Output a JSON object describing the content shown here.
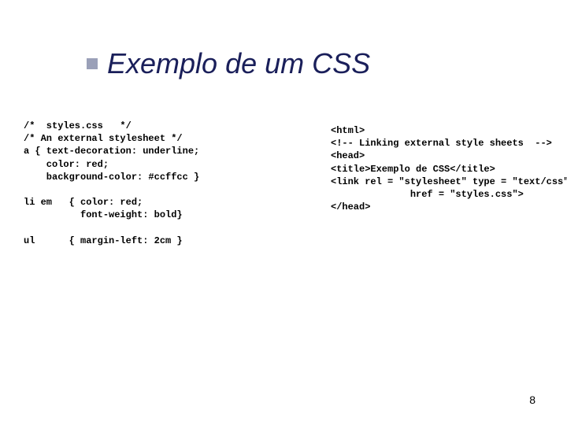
{
  "title": "Exemplo de um CSS",
  "left_code": "/*  styles.css   */\n/* An external stylesheet */\na { text-decoration: underline;\n    color: red; \n    background-color: #ccffcc }\n\nli em   { color: red; \n          font-weight: bold}\n\nul      { margin-left: 2cm }",
  "right_code": "<html>\n<!-- Linking external style sheets  -->\n<head>\n<title>Exemplo de CSS</title>\n<link rel = \"stylesheet\" type = \"text/css\"\n              href = \"styles.css\">\n</head>",
  "page_number": "8"
}
